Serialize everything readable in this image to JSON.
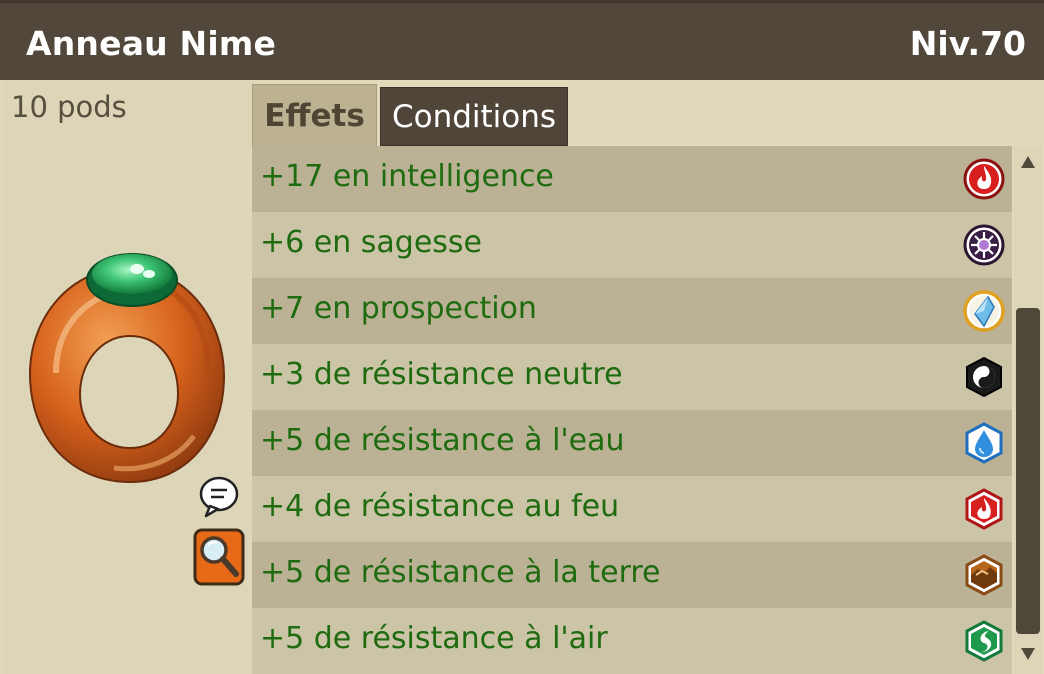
{
  "item": {
    "name": "Anneau Nime",
    "level": "Niv.70",
    "weight": "10 pods"
  },
  "tabs": [
    {
      "label": "Effets",
      "active": true
    },
    {
      "label": "Conditions",
      "active": false
    }
  ],
  "effects": [
    {
      "text": "+17 en intelligence",
      "icon": "fire-icon"
    },
    {
      "text": "+6 en sagesse",
      "icon": "wisdom-icon"
    },
    {
      "text": "+7 en prospection",
      "icon": "prospecting-icon"
    },
    {
      "text": "+3 de résistance neutre",
      "icon": "neutral-icon"
    },
    {
      "text": "+5 de résistance à l'eau",
      "icon": "water-icon"
    },
    {
      "text": "+4 de résistance au feu",
      "icon": "fire-icon"
    },
    {
      "text": "+5 de résistance à la terre",
      "icon": "earth-icon"
    },
    {
      "text": "+5 de résistance à l'air",
      "icon": "air-icon"
    }
  ],
  "colors": {
    "title_bar": "#51473a",
    "effect_text": "#1f6b10",
    "panel": "#ddd5b8"
  }
}
